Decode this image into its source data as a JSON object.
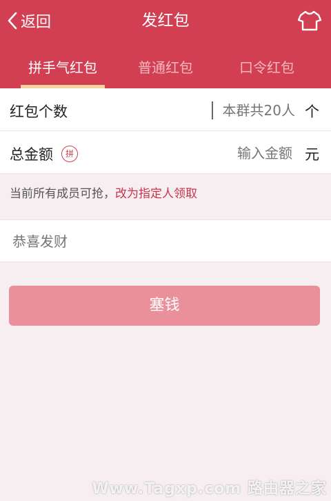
{
  "header": {
    "back_label": "返回",
    "title": "发红包",
    "shirt_icon": "shirt-icon",
    "color": "#d23f53"
  },
  "tabs": [
    {
      "label": "拼手气红包",
      "active": true
    },
    {
      "label": "普通红包",
      "active": false
    },
    {
      "label": "口令红包",
      "active": false
    }
  ],
  "form": {
    "count_label": "红包个数",
    "count_placeholder": "本群共20人",
    "count_unit": "个",
    "amount_label": "总金额",
    "amount_badge": "拼",
    "amount_placeholder": "输入金额",
    "amount_unit": "元"
  },
  "note": {
    "text": "当前所有成员可抢，",
    "link": "改为指定人领取"
  },
  "message": {
    "placeholder": "恭喜发财"
  },
  "send_button": "塞钱",
  "watermark": "Www.Tagxp.com 路由器之家"
}
